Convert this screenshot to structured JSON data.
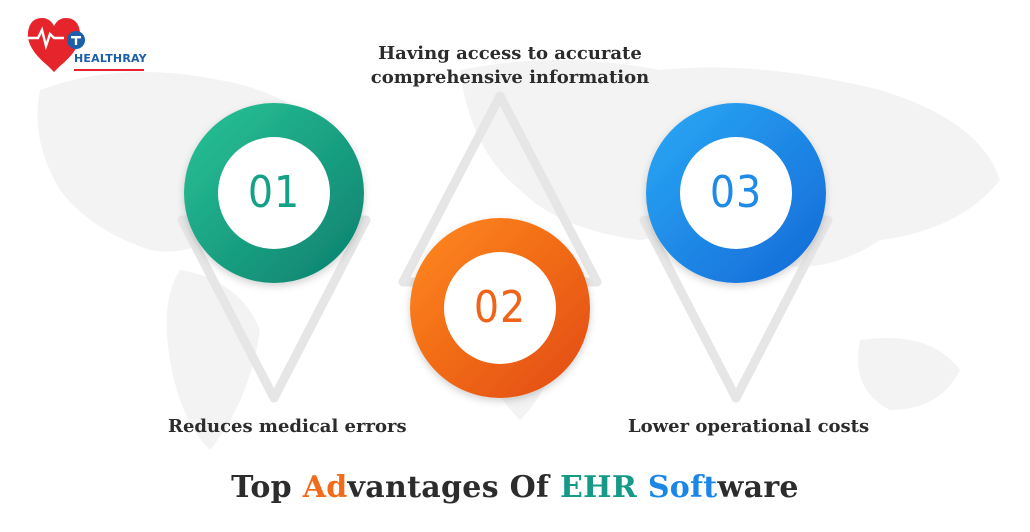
{
  "brand": {
    "name": "HEALTHRAY"
  },
  "steps": [
    {
      "number": "01",
      "label": "Reduces medical errors",
      "color": "#15a185"
    },
    {
      "number": "02",
      "label_line1": "Having access to accurate",
      "label_line2": "comprehensive information",
      "color": "#f06419"
    },
    {
      "number": "03",
      "label": "Lower operational costs",
      "color": "#1f8ae8"
    }
  ],
  "title": {
    "part1": "Top ",
    "part2": "Ad",
    "part3": "vantages Of ",
    "part4": "EHR",
    "part5": " ",
    "part6": "Soft",
    "part7": "ware"
  }
}
